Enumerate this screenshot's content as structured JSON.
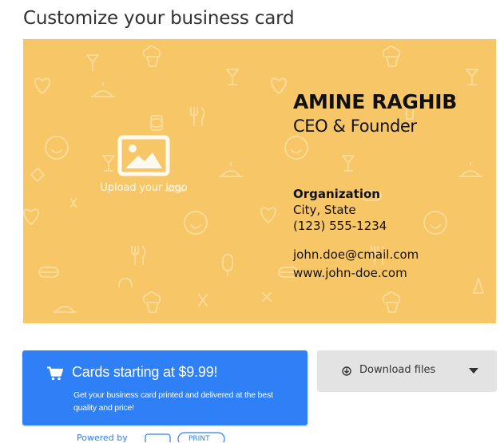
{
  "page": {
    "title": "Customize your business card"
  },
  "card": {
    "background_color": "#f7c666",
    "logo_placeholder_label": "Upload your logo",
    "name": "AMINE RAGHIB",
    "role": "CEO & Founder",
    "organization": "Organization",
    "city_state": "City, State",
    "phone": "(123) 555-1234",
    "email": "john.doe@cmail.com",
    "website": "www.john-doe.com"
  },
  "actions": {
    "order_button": {
      "title": "Cards starting at $9.99!",
      "subtitle": "Get your business card printed and delivered at the best quality and price!",
      "color": "#2f7ff7"
    },
    "download_button": {
      "label": "Download files",
      "color": "#e3e3e3"
    }
  },
  "footer": {
    "powered_by": "Powered by",
    "partner_logo_text": "PRINT"
  }
}
